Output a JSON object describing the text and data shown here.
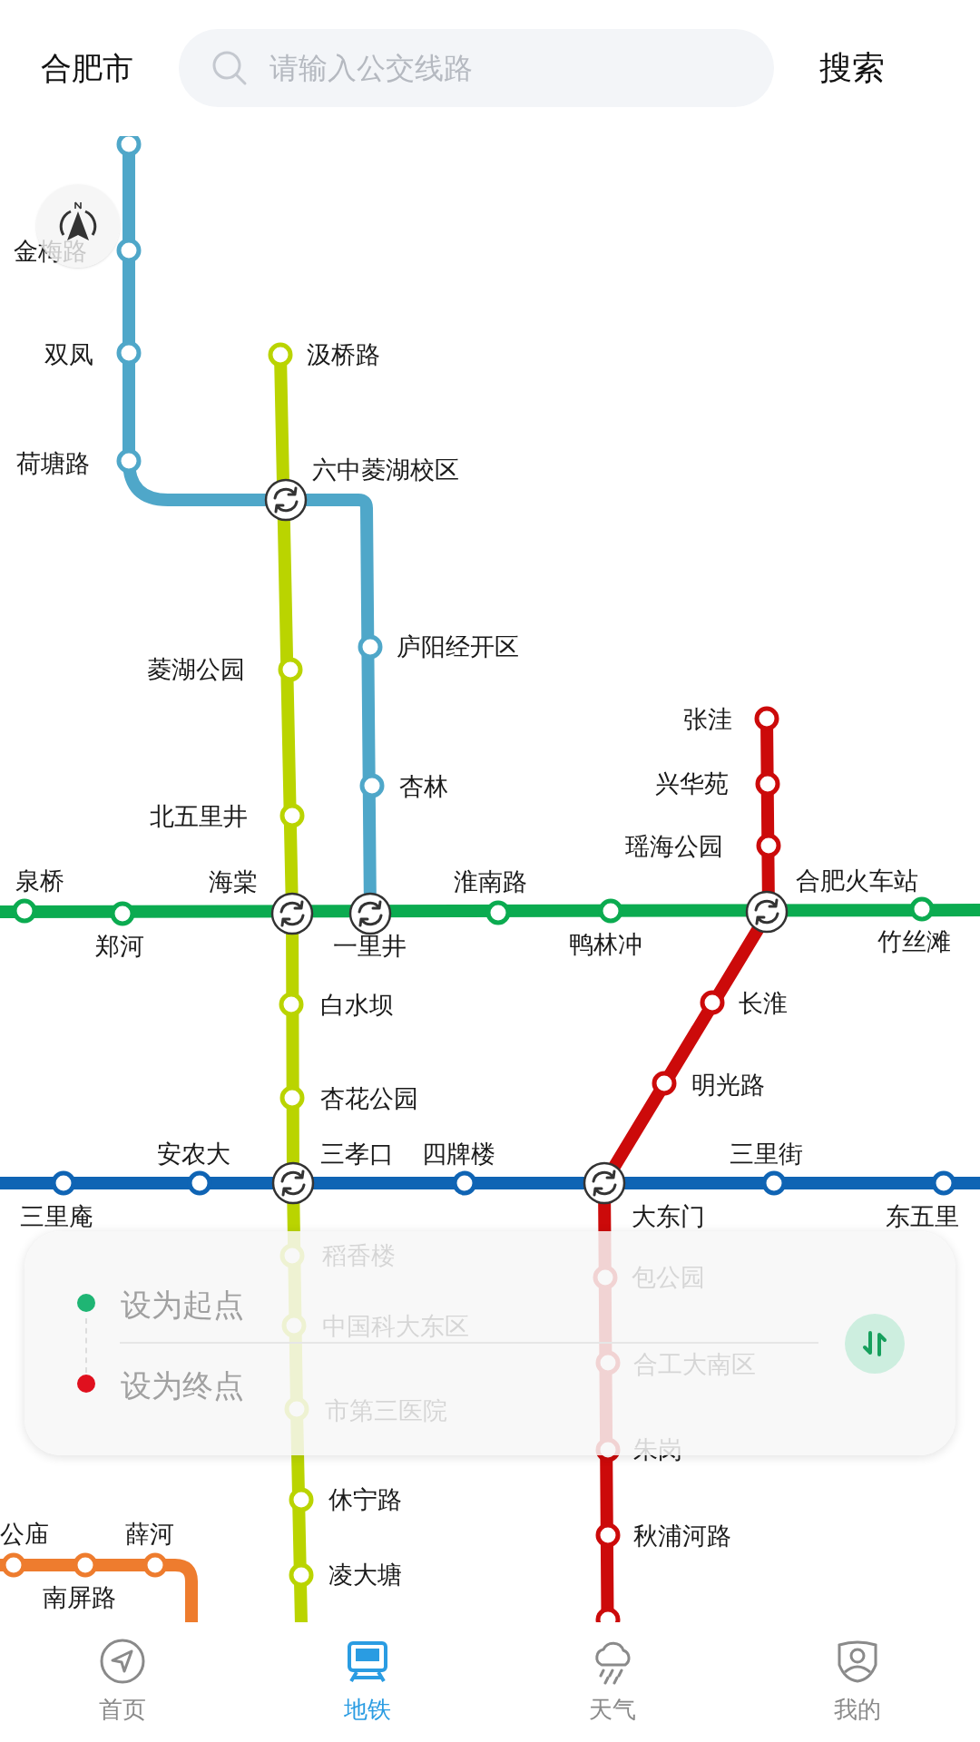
{
  "header": {
    "city": "合肥市",
    "search": {
      "placeholder": "请输入公交线路"
    },
    "search_button": "搜索"
  },
  "station_labels": [
    "金梅路",
    "双凤",
    "汲桥路",
    "荷塘路",
    "六中菱湖校区",
    "庐阳经开区",
    "菱湖公园",
    "张洼",
    "兴华苑",
    "杏林",
    "北五里井",
    "瑶海公园",
    "泉桥",
    "海棠",
    "淮南路",
    "合肥火车站",
    "郑河",
    "一里井",
    "鸭林冲",
    "竹丝滩",
    "白水坝",
    "长淮",
    "明光路",
    "杏花公园",
    "安农大",
    "三孝口",
    "四牌楼",
    "三里街",
    "三里庵",
    "大东门",
    "东五里",
    "稻香楼",
    "包公园",
    "中国科大东区",
    "合工大南区",
    "市第三医院",
    "朱岗",
    "休宁路",
    "公庙",
    "薛河",
    "秋浦河路",
    "凌大塘",
    "南屏路"
  ],
  "route_panel": {
    "start": {
      "label": "设为起点",
      "color": "#1fb574"
    },
    "end": {
      "label": "设为终点",
      "color": "#e0101e"
    }
  },
  "nav": [
    {
      "label": "首页",
      "kind": "home",
      "selected": false
    },
    {
      "label": "地铁",
      "kind": "metro",
      "selected": true
    },
    {
      "label": "天气",
      "kind": "weather",
      "selected": false
    },
    {
      "label": "我的",
      "kind": "profile",
      "selected": false
    }
  ]
}
